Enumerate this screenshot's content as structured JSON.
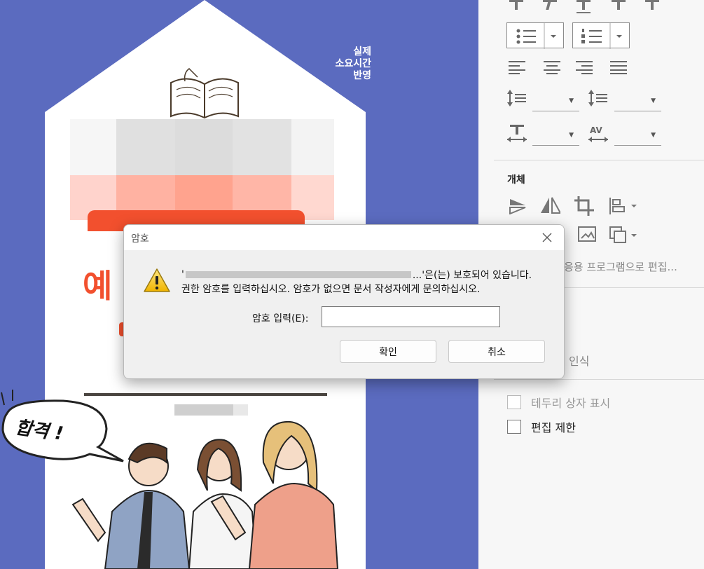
{
  "document": {
    "badge_lines": [
      "실제",
      "소요시간",
      "반영"
    ],
    "red_title_partial": "예",
    "speech_bubble_text": "합격 !"
  },
  "panel": {
    "section_object_label": "개체",
    "edit_with_app_label": "응용 프로그램으로 편집...",
    "recognize_label": "인식",
    "checkbox_border_label": "테두리 상자 표시",
    "checkbox_restrict_label": "편집 제한"
  },
  "dialog": {
    "title": "암호",
    "message_line1_prefix": "'",
    "message_line1_suffix": "...'은(는) 보호되어 있습니다.",
    "message_line2": "권한 암호를 입력하십시오. 암호가 없으면 문서 작성자에게 문의하십시오.",
    "password_label": "암호 입력(E):",
    "password_value": "",
    "ok_label": "확인",
    "cancel_label": "취소",
    "icons": {
      "warning": "warning-icon",
      "close": "close-icon"
    }
  },
  "colors": {
    "canvas_bg": "#5b6bbf",
    "accent_red": "#f2502e",
    "panel_bg": "#f7f7f7",
    "dialog_bg": "#f0f0f0"
  }
}
